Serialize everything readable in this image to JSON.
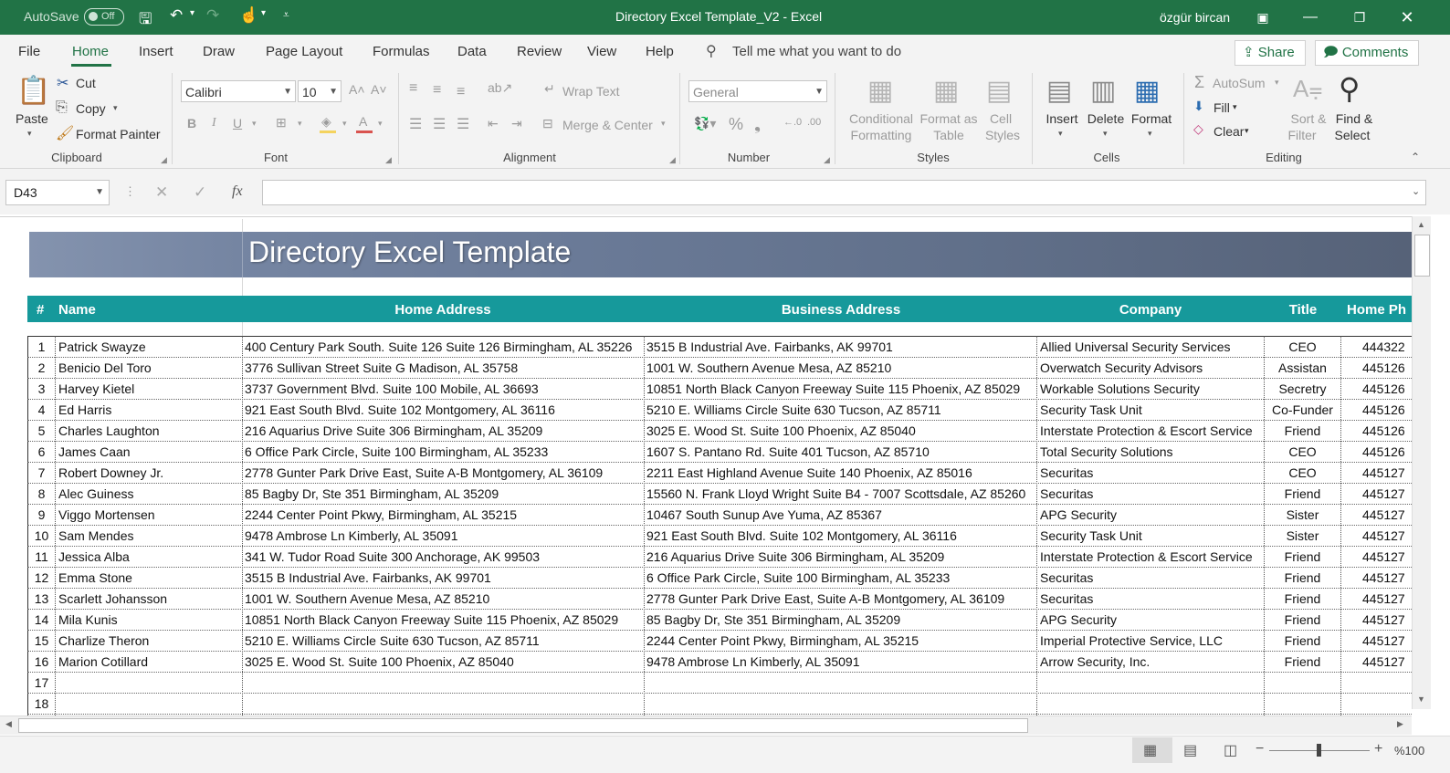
{
  "titlebar": {
    "autosave_label": "AutoSave",
    "autosave_state": "Off",
    "title": "Directory Excel Template_V2  -  Excel",
    "user": "özgür bircan"
  },
  "menu": {
    "items": [
      "File",
      "Home",
      "Insert",
      "Draw",
      "Page Layout",
      "Formulas",
      "Data",
      "Review",
      "View",
      "Help"
    ],
    "tell_me": "Tell me what you want to do",
    "share": "Share",
    "comments": "Comments"
  },
  "ribbon": {
    "clipboard": {
      "paste": "Paste",
      "cut": "Cut",
      "copy": "Copy",
      "format_painter": "Format Painter",
      "label": "Clipboard"
    },
    "font": {
      "name": "Calibri",
      "size": "10",
      "label": "Font"
    },
    "alignment": {
      "wrap_text": "Wrap Text",
      "merge_center": "Merge & Center",
      "label": "Alignment"
    },
    "number": {
      "format": "General",
      "label": "Number"
    },
    "styles": {
      "conditional": "Conditional",
      "formatting": "Formatting",
      "format_as": "Format as",
      "table": "Table",
      "cell": "Cell",
      "styles": "Styles",
      "label": "Styles"
    },
    "cells": {
      "insert": "Insert",
      "delete": "Delete",
      "format": "Format",
      "label": "Cells"
    },
    "editing": {
      "autosum": "AutoSum",
      "fill": "Fill",
      "clear": "Clear",
      "sort": "Sort &",
      "filter": "Filter",
      "find": "Find &",
      "select": "Select",
      "label": "Editing"
    }
  },
  "formula_bar": {
    "name_box": "D43",
    "formula": ""
  },
  "sheet": {
    "title": "Directory Excel Template",
    "headers": {
      "num": "#",
      "name": "Name",
      "home": "Home Address",
      "business": "Business Address",
      "company": "Company",
      "title": "Title",
      "phone": "Home Ph"
    },
    "rows": [
      {
        "n": "1",
        "name": "Patrick Swayze",
        "home": "400 Century Park South. Suite 126 Suite 126 Birmingham, AL 35226",
        "business": "3515 B Industrial Ave. Fairbanks, AK 99701",
        "company": "Allied Universal Security Services",
        "title": "CEO",
        "phone": "444322"
      },
      {
        "n": "2",
        "name": "Benicio Del Toro",
        "home": "3776 Sullivan Street Suite G Madison, AL 35758",
        "business": "1001 W. Southern Avenue Mesa, AZ 85210",
        "company": "Overwatch Security Advisors",
        "title": "Assistan",
        "phone": "445126"
      },
      {
        "n": "3",
        "name": "Harvey Kietel",
        "home": "3737 Government Blvd. Suite 100 Mobile, AL 36693",
        "business": "10851 North Black Canyon Freeway Suite 115 Phoenix, AZ 85029",
        "company": "Workable Solutions Security",
        "title": "Secretry",
        "phone": "445126"
      },
      {
        "n": "4",
        "name": "Ed Harris",
        "home": "921 East South Blvd. Suite 102 Montgomery, AL 36116",
        "business": "5210 E. Williams Circle Suite 630 Tucson, AZ 85711",
        "company": "Security Task Unit",
        "title": "Co-Funder",
        "phone": "445126"
      },
      {
        "n": "5",
        "name": "Charles Laughton",
        "home": "216 Aquarius Drive Suite 306 Birmingham, AL 35209",
        "business": "3025 E. Wood St. Suite 100 Phoenix, AZ 85040",
        "company": "Interstate Protection & Escort Service",
        "title": "Friend",
        "phone": "445126"
      },
      {
        "n": "6",
        "name": "James Caan",
        "home": "6 Office Park Circle, Suite 100 Birmingham, AL 35233",
        "business": "1607 S. Pantano Rd. Suite 401 Tucson, AZ 85710",
        "company": "Total Security Solutions",
        "title": "CEO",
        "phone": "445126"
      },
      {
        "n": "7",
        "name": "Robert Downey Jr.",
        "home": "2778 Gunter Park Drive East, Suite A-B Montgomery, AL 36109",
        "business": "2211 East Highland Avenue Suite 140 Phoenix, AZ 85016",
        "company": "Securitas",
        "title": "CEO",
        "phone": "445127"
      },
      {
        "n": "8",
        "name": "Alec Guiness",
        "home": "85 Bagby Dr, Ste 351 Birmingham, AL 35209",
        "business": "15560 N. Frank Lloyd Wright Suite B4 - 7007 Scottsdale, AZ 85260",
        "company": "Securitas",
        "title": "Friend",
        "phone": "445127"
      },
      {
        "n": "9",
        "name": "Viggo Mortensen",
        "home": "2244 Center Point Pkwy, Birmingham, AL 35215",
        "business": "10467 South Sunup Ave Yuma, AZ 85367",
        "company": "APG Security",
        "title": "Sister",
        "phone": "445127"
      },
      {
        "n": "10",
        "name": "Sam Mendes",
        "home": "9478 Ambrose Ln Kimberly, AL 35091",
        "business": "921 East South Blvd. Suite 102 Montgomery, AL 36116",
        "company": "Security Task Unit",
        "title": "Sister",
        "phone": "445127"
      },
      {
        "n": "11",
        "name": "Jessica Alba",
        "home": "341 W. Tudor Road Suite 300 Anchorage, AK 99503",
        "business": "216 Aquarius Drive Suite 306 Birmingham, AL 35209",
        "company": "Interstate Protection & Escort Service",
        "title": "Friend",
        "phone": "445127"
      },
      {
        "n": "12",
        "name": "Emma Stone",
        "home": "3515 B Industrial Ave. Fairbanks, AK 99701",
        "business": "6 Office Park Circle, Suite 100 Birmingham, AL 35233",
        "company": "Securitas",
        "title": "Friend",
        "phone": "445127"
      },
      {
        "n": "13",
        "name": "Scarlett Johansson",
        "home": "1001 W. Southern Avenue Mesa, AZ 85210",
        "business": "2778 Gunter Park Drive East, Suite A-B Montgomery, AL 36109",
        "company": "Securitas",
        "title": "Friend",
        "phone": "445127"
      },
      {
        "n": "14",
        "name": "Mila Kunis",
        "home": "10851 North Black Canyon Freeway Suite 115 Phoenix, AZ 85029",
        "business": "85 Bagby Dr, Ste 351 Birmingham, AL 35209",
        "company": "APG Security",
        "title": "Friend",
        "phone": "445127"
      },
      {
        "n": "15",
        "name": "Charlize Theron",
        "home": "5210 E. Williams Circle Suite 630 Tucson, AZ 85711",
        "business": "2244 Center Point Pkwy, Birmingham, AL 35215",
        "company": "Imperial Protective Service, LLC",
        "title": "Friend",
        "phone": "445127"
      },
      {
        "n": "16",
        "name": "Marion Cotillard",
        "home": "3025 E. Wood St. Suite 100 Phoenix, AZ 85040",
        "business": "9478 Ambrose Ln Kimberly, AL 35091",
        "company": "Arrow Security, Inc.",
        "title": "Friend",
        "phone": "445127"
      },
      {
        "n": "17",
        "name": "",
        "home": "",
        "business": "",
        "company": "",
        "title": "",
        "phone": ""
      },
      {
        "n": "18",
        "name": "",
        "home": "",
        "business": "",
        "company": "",
        "title": "",
        "phone": ""
      }
    ]
  },
  "status": {
    "zoom": "%100"
  },
  "colors": {
    "excel_green": "#217346",
    "header_teal": "#16999b",
    "banner": "#6a7a97"
  }
}
